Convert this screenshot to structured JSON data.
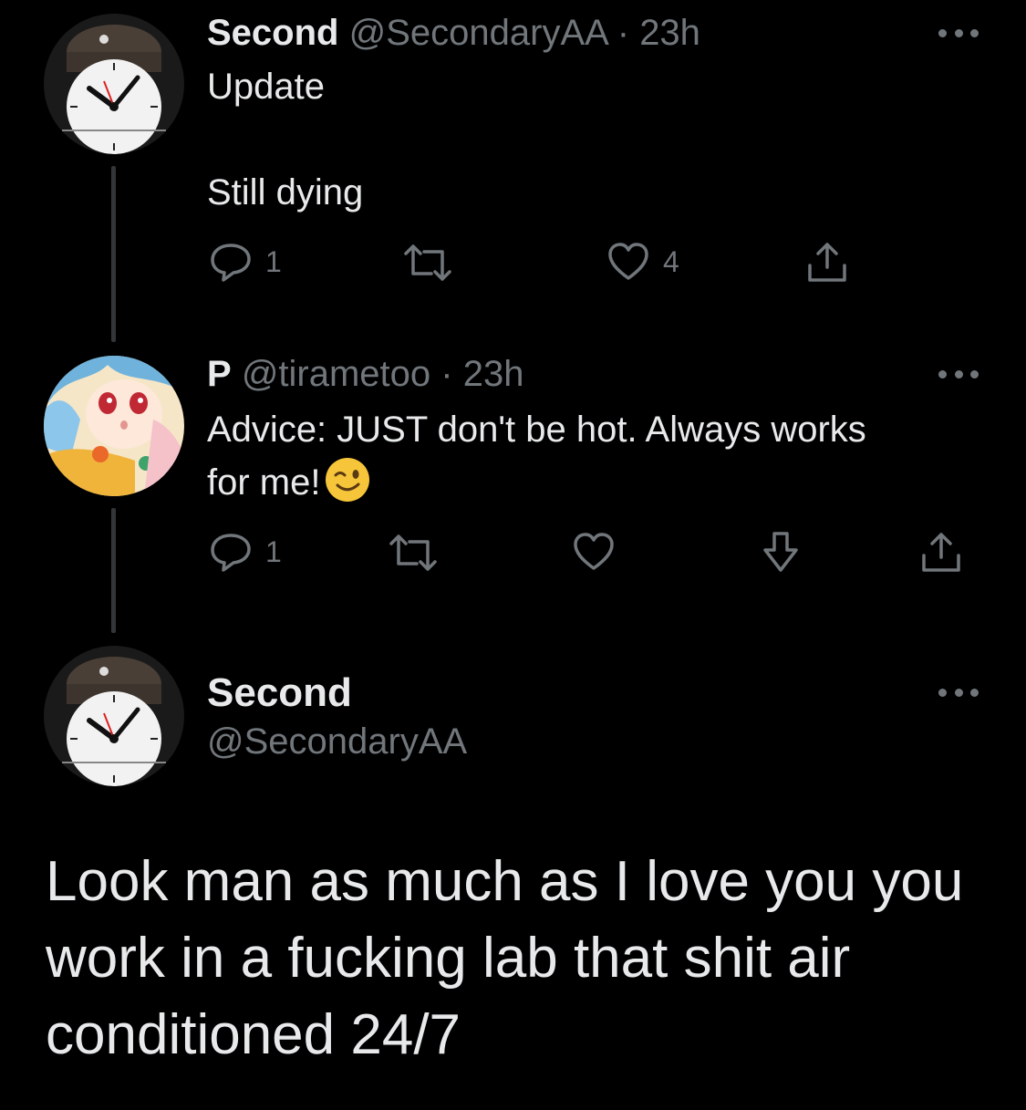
{
  "tweets": [
    {
      "name": "Second",
      "handle": "@SecondaryAA",
      "separator": "·",
      "time": "23h",
      "lines": [
        "Update",
        "Still dying"
      ],
      "avatar": "clock-face-avatar",
      "actions": {
        "reply_count": "1",
        "retweet_count": "",
        "like_count": "4"
      }
    },
    {
      "name": "P",
      "handle": "@tirametoo",
      "separator": "·",
      "time": "23h",
      "lines": [
        "Advice: JUST don't be hot. Always works",
        "for me!"
      ],
      "emoji": "winking-face",
      "avatar": "anime-character-avatar",
      "actions": {
        "reply_count": "1",
        "retweet_count": "",
        "like_count": ""
      }
    }
  ],
  "main_tweet": {
    "name": "Second",
    "handle": "@SecondaryAA",
    "avatar": "clock-face-avatar",
    "text": "Look man as much as I love you you work in a fucking lab that shit air conditioned 24/7"
  },
  "colors": {
    "background": "#000000",
    "text": "#e7e9ea",
    "muted": "#71767b",
    "thread_line": "#333639"
  }
}
